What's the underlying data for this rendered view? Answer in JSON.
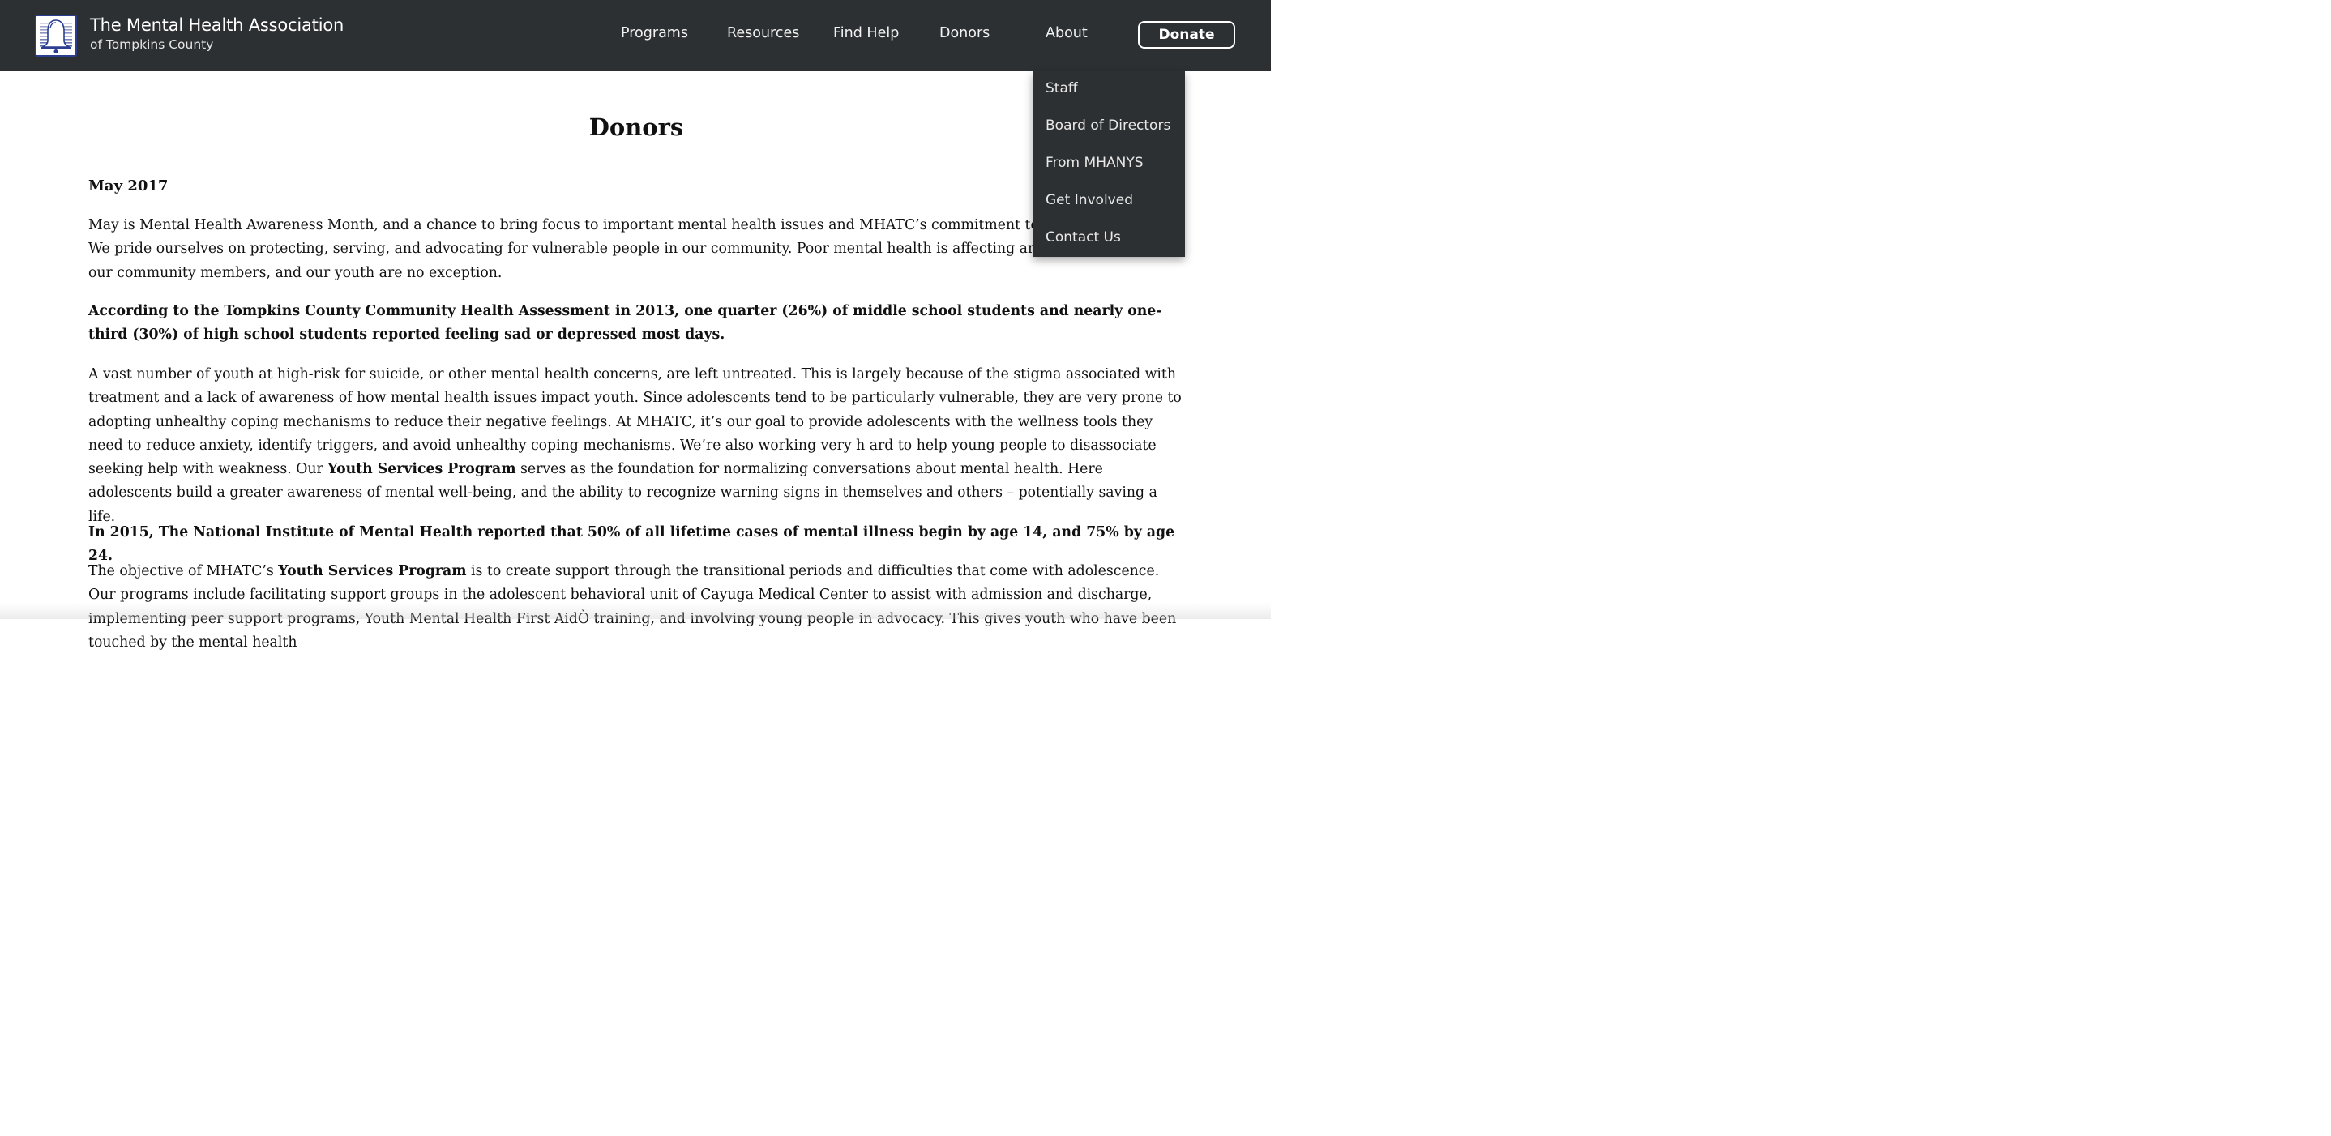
{
  "header": {
    "org_name": "The Mental Health Association",
    "org_sub": "of Tompkins County",
    "nav": {
      "programs": "Programs",
      "resources": "Resources",
      "find_help": "Find Help",
      "donors": "Donors",
      "about": "About"
    },
    "donate_label": "Donate"
  },
  "about_menu": {
    "items": [
      "Staff",
      "Board of Directors",
      "From MHANYS",
      "Get Involved",
      "Contact Us"
    ]
  },
  "main": {
    "title": "Donors",
    "date_heading": "May 2017",
    "p1": "May is Mental Health Awareness Month, and a chance to bring focus to important mental health issues and MHATC’s commitment to addressing them. We pride ourselves on protecting, serving, and advocating for vulnerable people in our community. Poor mental health is affecting an increasing range of our community members, and our youth are no exception.",
    "p2": "According to the Tompkins County Community Health Assessment in 2013, one quarter (26%) of middle school students and nearly one-third (30%) of high school students reported feeling sad or depressed most days.",
    "p3_a": "A vast number of youth at high-risk for suicide, or other mental health concerns, are left untreated. This is largely because of the stigma associated with treatment and a lack of awareness of how mental health issues impact youth. Since adolescents tend to be particularly vulnerable, they are very prone to adopting unhealthy coping mechanisms to reduce their negative feelings. At MHATC, it’s our goal to provide adolescents with the wellness tools they need to reduce anxiety, identify triggers, and avoid unhealthy coping mechanisms. We’re also working very h ard to help young people to disassociate seeking help with weakness. Our ",
    "p3_b": "Youth Services Program",
    "p3_c": " serves as the foundation for normalizing conversations about mental health. Here adolescents build a greater awareness of mental well-being, and the ability to recognize warning signs in themselves and others – potentially saving a life.",
    "p4": "In 2015, The National Institute of Mental Health reported that 50% of all lifetime cases of mental illness begin by age 14, and 75% by age 24.",
    "p5_a": "The objective of MHATC’s ",
    "p5_b": "Youth Services Program",
    "p5_c": " is to create support through the transitional periods and difficulties that come with adolescence. Our programs include facilitating support groups in the adolescent behavioral unit of Cayuga Medical Center to assist with admission and discharge, implementing peer support programs, Youth Mental Health First AidÒ training, and involving young people in advocacy. This gives youth who have been touched by the mental health"
  },
  "colors": {
    "header_bg": "#2d3033",
    "logo_blue": "#2a3d8f"
  }
}
